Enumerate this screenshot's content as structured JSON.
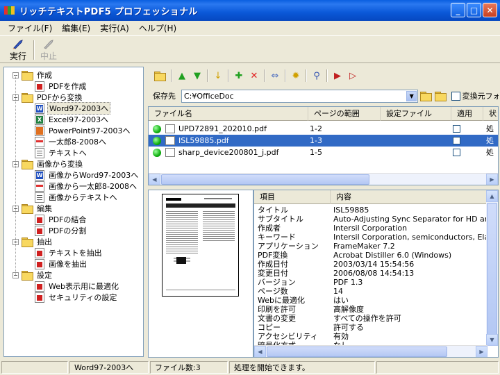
{
  "window": {
    "title": "リッチテキストPDF5 プロフェッショナル"
  },
  "menu": [
    "ファイル(F)",
    "編集(E)",
    "実行(A)",
    "ヘルプ(H)"
  ],
  "toolbar": {
    "run_label": "実行",
    "stop_label": "中止"
  },
  "tree": [
    {
      "label": "作成",
      "level": 0,
      "icon": "folder"
    },
    {
      "label": "PDFを作成",
      "level": 1,
      "icon": "pdf"
    },
    {
      "label": "PDFから変換",
      "level": 0,
      "icon": "folder"
    },
    {
      "label": "Word97-2003へ",
      "level": 1,
      "icon": "word",
      "selected": true
    },
    {
      "label": "Excel97-2003へ",
      "level": 1,
      "icon": "excel"
    },
    {
      "label": "PowerPoint97-2003へ",
      "level": 1,
      "icon": "ppt"
    },
    {
      "label": "一太郎8-2008へ",
      "level": 1,
      "icon": "ichi"
    },
    {
      "label": "テキストへ",
      "level": 1,
      "icon": "txt"
    },
    {
      "label": "画像から変換",
      "level": 0,
      "icon": "folder"
    },
    {
      "label": "画像からWord97-2003へ",
      "level": 1,
      "icon": "word"
    },
    {
      "label": "画像から一太郎8-2008へ",
      "level": 1,
      "icon": "ichi"
    },
    {
      "label": "画像からテキストへ",
      "level": 1,
      "icon": "txt"
    },
    {
      "label": "編集",
      "level": 0,
      "icon": "folder"
    },
    {
      "label": "PDFの結合",
      "level": 1,
      "icon": "pdf"
    },
    {
      "label": "PDFの分割",
      "level": 1,
      "icon": "pdf"
    },
    {
      "label": "抽出",
      "level": 0,
      "icon": "folder"
    },
    {
      "label": "テキストを抽出",
      "level": 1,
      "icon": "pdf"
    },
    {
      "label": "画像を抽出",
      "level": 1,
      "icon": "pdf"
    },
    {
      "label": "設定",
      "level": 0,
      "icon": "folder"
    },
    {
      "label": "Web表示用に最適化",
      "level": 1,
      "icon": "pdf"
    },
    {
      "label": "セキュリティの設定",
      "level": 1,
      "icon": "pdf"
    }
  ],
  "save": {
    "label": "保存先",
    "path": "C:¥OfficeDoc",
    "source_folder_label": "変換元フォ"
  },
  "files": {
    "columns": [
      "ファイル名",
      "ページの範囲",
      "設定ファイル",
      "適用",
      "状"
    ],
    "rows": [
      {
        "name": "UPD72891_202010.pdf",
        "range": "1-2",
        "status": "処"
      },
      {
        "name": "ISL59885.pdf",
        "range": "1-3",
        "status": "処",
        "selected": true
      },
      {
        "name": "sharp_device200801_j.pdf",
        "range": "1-5",
        "status": "処"
      }
    ]
  },
  "properties": {
    "columns": [
      "項目",
      "内容"
    ],
    "rows": [
      [
        "タイトル",
        "ISL59885"
      ],
      [
        "サブタイトル",
        "Auto-Adjusting Sync Separator for HD and"
      ],
      [
        "作成者",
        "Intersil Corporation"
      ],
      [
        "キーワード",
        "Intersil Corporation, semiconductors, Elant"
      ],
      [
        "アプリケーション",
        "FrameMaker 7.2"
      ],
      [
        "PDF変換",
        "Acrobat Distiller 6.0 (Windows)"
      ],
      [
        "作成日付",
        "2003/03/14 15:54:56"
      ],
      [
        "変更日付",
        "2006/08/08 14:54:13"
      ],
      [
        "バージョン",
        "PDF 1.3"
      ],
      [
        "ページ数",
        "14"
      ],
      [
        "Webに最適化",
        "はい"
      ],
      [
        "印刷を許可",
        "高解像度"
      ],
      [
        "文書の変更",
        "すべての操作を許可"
      ],
      [
        "コピー",
        "許可する"
      ],
      [
        "アクセシビリティ",
        "有効"
      ],
      [
        "暗号化方式",
        "なし"
      ]
    ]
  },
  "status": {
    "current": "Word97-2003へ",
    "file_count": "ファイル数:3",
    "message": "処理を開始できます。"
  }
}
